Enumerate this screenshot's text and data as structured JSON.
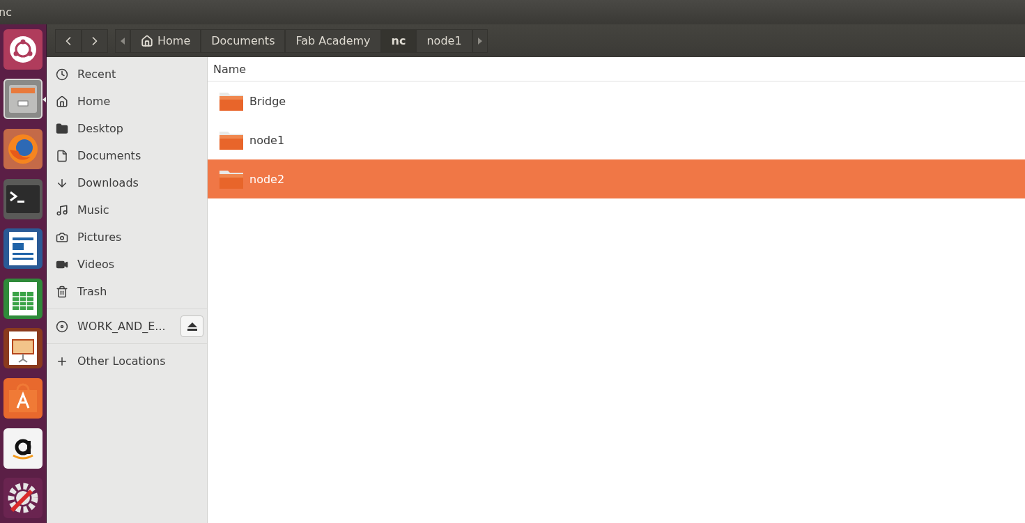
{
  "window": {
    "title": "nc"
  },
  "launcher": [
    {
      "kind": "ubuntu",
      "running": false
    },
    {
      "kind": "files",
      "running": true
    },
    {
      "kind": "firefox",
      "running": false
    },
    {
      "kind": "terminal",
      "running": false
    },
    {
      "kind": "writer",
      "running": false
    },
    {
      "kind": "calc",
      "running": false
    },
    {
      "kind": "impress",
      "running": false
    },
    {
      "kind": "software",
      "running": false
    },
    {
      "kind": "amazon",
      "running": false
    },
    {
      "kind": "settings",
      "running": false
    }
  ],
  "pathbar": {
    "crumbs": [
      {
        "label": "Home",
        "kind": "home",
        "selected": false
      },
      {
        "label": "Documents",
        "kind": "folder",
        "selected": false
      },
      {
        "label": "Fab Academy",
        "kind": "folder",
        "selected": false
      },
      {
        "label": "nc",
        "kind": "folder",
        "selected": true
      },
      {
        "label": "node1",
        "kind": "folder",
        "selected": false
      }
    ]
  },
  "sidebar": {
    "places": [
      {
        "label": "Recent",
        "kind": "recent"
      },
      {
        "label": "Home",
        "kind": "home"
      },
      {
        "label": "Desktop",
        "kind": "desktop"
      },
      {
        "label": "Documents",
        "kind": "documents"
      },
      {
        "label": "Downloads",
        "kind": "downloads"
      },
      {
        "label": "Music",
        "kind": "music"
      },
      {
        "label": "Pictures",
        "kind": "pictures"
      },
      {
        "label": "Videos",
        "kind": "videos"
      },
      {
        "label": "Trash",
        "kind": "trash"
      }
    ],
    "devices": [
      {
        "label": "WORK_AND_E...",
        "kind": "disc",
        "ejectable": true
      }
    ],
    "other": [
      {
        "label": "Other Locations",
        "kind": "plus"
      }
    ]
  },
  "files": {
    "columns": [
      "Name"
    ],
    "rows": [
      {
        "name": "Bridge",
        "selected": false
      },
      {
        "name": "node1",
        "selected": false
      },
      {
        "name": "node2",
        "selected": true
      }
    ]
  }
}
